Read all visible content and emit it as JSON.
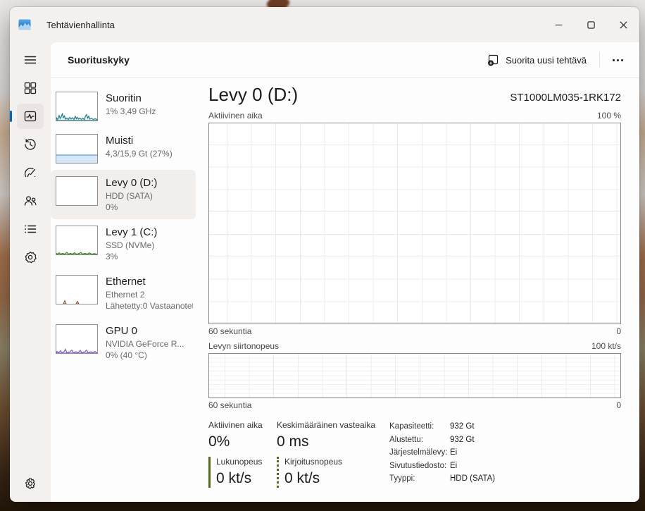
{
  "window": {
    "title": "Tehtävienhallinta"
  },
  "header": {
    "title": "Suorituskyky",
    "run_new_task_label": "Suorita uusi tehtävä"
  },
  "nav_rail": {
    "icons": [
      "menu-icon",
      "processes-icon",
      "performance-icon",
      "app-history-icon",
      "startup-apps-icon",
      "users-icon",
      "details-icon",
      "services-icon",
      "settings-icon"
    ],
    "selected": "performance-icon"
  },
  "perf_list": {
    "items": [
      {
        "id": "cpu",
        "title": "Suoritin",
        "sub1": "1%  3,49 GHz"
      },
      {
        "id": "memory",
        "title": "Muisti",
        "sub1": "4,3/15,9 Gt (27%)"
      },
      {
        "id": "disk0",
        "title": "Levy 0 (D:)",
        "sub1": "HDD (SATA)",
        "sub2": "0%",
        "selected": true
      },
      {
        "id": "disk1",
        "title": "Levy 1 (C:)",
        "sub1": "SSD (NVMe)",
        "sub2": "3%"
      },
      {
        "id": "ethernet",
        "title": "Ethernet",
        "sub1": "Ethernet 2",
        "sub2": "Lähetetty:0 Vastaanotet"
      },
      {
        "id": "gpu",
        "title": "GPU 0",
        "sub1": "NVIDIA GeForce R...",
        "sub2": "0% (40 °C)"
      }
    ]
  },
  "main": {
    "title": "Levy 0 (D:)",
    "device": "ST1000LM035-1RK172",
    "chart_active": {
      "label": "Aktiivinen aika",
      "y_max": "100 %",
      "x_left": "60 sekuntia",
      "x_right": "0"
    },
    "chart_transfer": {
      "label": "Levyn siirtonopeus",
      "y_max": "100 kt/s",
      "x_left": "60 sekuntia",
      "x_right": "0"
    },
    "stats": {
      "active_time": {
        "label": "Aktiivinen aika",
        "value": "0%"
      },
      "avg_response": {
        "label": "Keskimääräinen vasteaika",
        "value": "0 ms"
      },
      "read_speed": {
        "label": "Lukunopeus",
        "value": "0 kt/s"
      },
      "write_speed": {
        "label": "Kirjoitusnopeus",
        "value": "0 kt/s"
      },
      "details": [
        {
          "label": "Kapasiteetti:",
          "value": "932 Gt"
        },
        {
          "label": "Alustettu:",
          "value": "932 Gt"
        },
        {
          "label": "Järjestelmälevy:",
          "value": "Ei"
        },
        {
          "label": "Sivutustiedosto:",
          "value": "Ei"
        },
        {
          "label": "Tyyppi:",
          "value": "HDD (SATA)"
        }
      ]
    }
  },
  "colors": {
    "accent": "#0067c0",
    "stat_green": "#51691d",
    "cpu_spark": "#1c7a8a",
    "memory_spark": "#5a9bd5",
    "disk_spark": "#3e7a1e",
    "ethernet_spark": "#8a4a32",
    "gpu_spark": "#8254c8"
  }
}
